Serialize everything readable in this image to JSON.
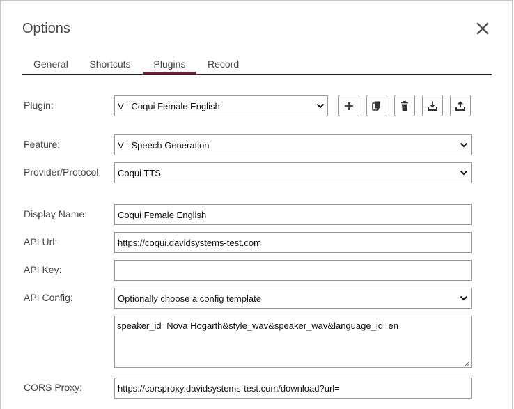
{
  "dialog": {
    "title": "Options",
    "close_icon": "close-icon"
  },
  "tabs": [
    {
      "label": "General",
      "active": false
    },
    {
      "label": "Shortcuts",
      "active": false
    },
    {
      "label": "Plugins",
      "active": true
    },
    {
      "label": "Record",
      "active": false
    }
  ],
  "accent_color": "#7a1a33",
  "plugin": {
    "label": "Plugin:",
    "selected": "V   Coqui Female English",
    "actions": [
      "add-icon",
      "copy-icon",
      "trash-icon",
      "download-icon",
      "upload-icon"
    ]
  },
  "feature": {
    "label": "Feature:",
    "selected": "V   Speech Generation"
  },
  "provider": {
    "label": "Provider/Protocol:",
    "selected": "Coqui TTS"
  },
  "display_name": {
    "label": "Display Name:",
    "value": "Coqui Female English"
  },
  "api_url": {
    "label": "API Url:",
    "value": "https://coqui.davidsystems-test.com"
  },
  "api_key": {
    "label": "API Key:",
    "value": ""
  },
  "api_config": {
    "label": "API Config:",
    "selected": "Optionally choose a config template",
    "text": "speaker_id=Nova Hogarth&style_wav&speaker_wav&language_id=en"
  },
  "cors_proxy": {
    "label": "CORS Proxy:",
    "value": "https://corsproxy.davidsystems-test.com/download?url="
  }
}
